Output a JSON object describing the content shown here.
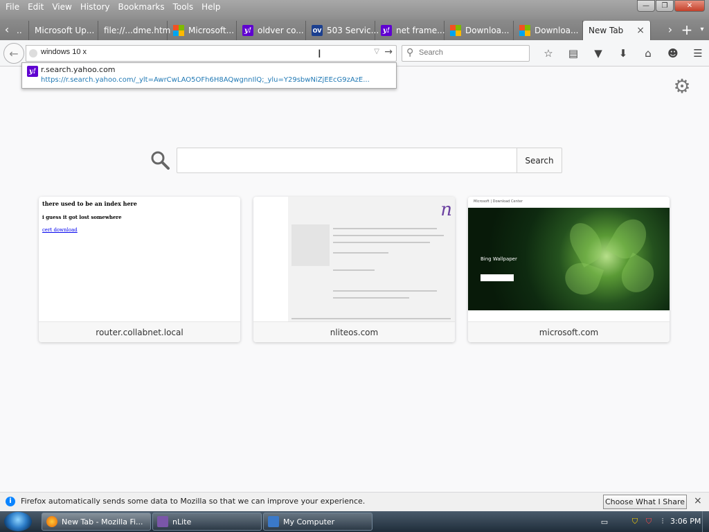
{
  "menubar": {
    "items": [
      "File",
      "Edit",
      "View",
      "History",
      "Bookmarks",
      "Tools",
      "Help"
    ]
  },
  "window_controls": {
    "minimize": "—",
    "restore": "❐",
    "close": "✕"
  },
  "tabs": [
    {
      "label": "..",
      "favicon": "none"
    },
    {
      "label": "Microsoft Up...",
      "favicon": "none"
    },
    {
      "label": "file://...dme.htm",
      "favicon": "none"
    },
    {
      "label": "Microsoft...",
      "favicon": "microsoft-icon"
    },
    {
      "label": "oldver co...",
      "favicon": "yahoo-icon"
    },
    {
      "label": "503 Servic...",
      "favicon": "ov-icon"
    },
    {
      "label": "net frame...",
      "favicon": "yahoo-icon"
    },
    {
      "label": "Downloa...",
      "favicon": "microsoft-icon"
    },
    {
      "label": "Downloa...",
      "favicon": "microsoft-icon"
    }
  ],
  "active_tab": {
    "label": "New Tab",
    "close": "×"
  },
  "favicon_text": {
    "yahoo": "y!",
    "ov": "OV"
  },
  "urlbar": {
    "value": "windows 10 x"
  },
  "searchbar": {
    "placeholder": "Search"
  },
  "autocomplete": {
    "title": "r.search.yahoo.com",
    "url": "https://r.search.yahoo.com/_ylt=AwrCwLAO5OFh6H8AQwgnnIlQ;_ylu=Y29sbwNiZjEEcG9zAzE..."
  },
  "newtab": {
    "search_button": "Search",
    "tiles": [
      {
        "label": "router.collabnet.local",
        "heading": "there used to be an index here",
        "subtext": "i guess it got lost somewhere",
        "link": "cert download"
      },
      {
        "label": "nliteos.com",
        "logo": "n"
      },
      {
        "label": "microsoft.com",
        "header": "Microsoft | Download Center",
        "caption": "Bing Wallpaper"
      }
    ]
  },
  "notification": {
    "message": "Firefox automatically sends some data to Mozilla so that we can improve your experience.",
    "button": "Choose What I Share",
    "close": "×"
  },
  "taskbar": {
    "items": [
      {
        "label": "New Tab - Mozilla Fi...",
        "active": true
      },
      {
        "label": "nLite",
        "active": false
      },
      {
        "label": "My Computer",
        "active": false
      }
    ],
    "clock": "3:06 PM"
  },
  "colors": {
    "link_blue": "#1f78b4",
    "yahoo_purple": "#5f01d1",
    "info_blue": "#0a84ff"
  }
}
